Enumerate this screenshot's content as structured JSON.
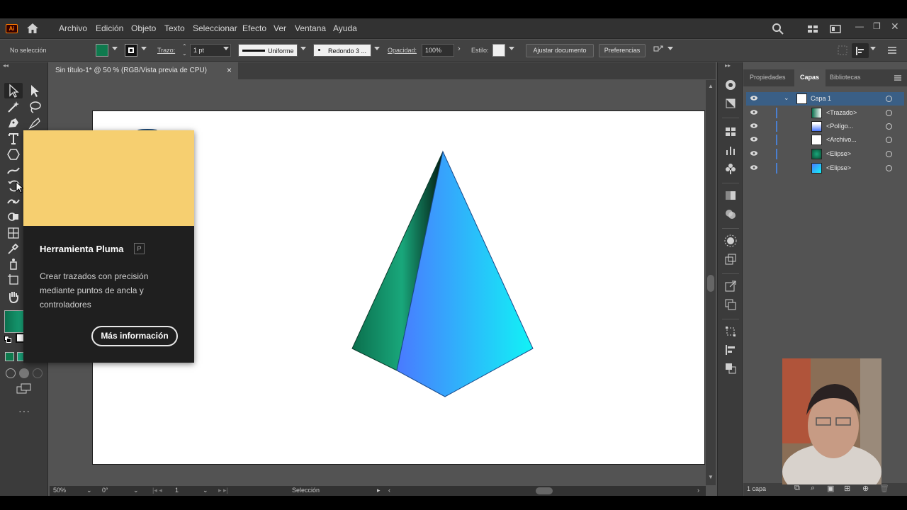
{
  "menubar": {
    "logo": "Ai",
    "items": [
      "Archivo",
      "Edición",
      "Objeto",
      "Texto",
      "Seleccionar",
      "Efecto",
      "Ver",
      "Ventana",
      "Ayuda"
    ],
    "icons": [
      "home-icon",
      "search-icon",
      "arrange-documents-icon",
      "screen-mode-icon",
      "minimize-icon",
      "restore-icon",
      "close-icon"
    ]
  },
  "controlbar": {
    "selection_status": "No selección",
    "stroke_label": "Trazo:",
    "stroke_weight": "1 pt",
    "stroke_profile": "Uniforme",
    "brush": "Redondo 3 ...",
    "opacity_label": "Opacidad:",
    "opacity_value": "100%",
    "style_label": "Estilo:",
    "adjust_document_button": "Ajustar documento",
    "preferences_button": "Preferencias",
    "colors": {
      "fill": "#0f7a4e",
      "stroke": "#111111"
    }
  },
  "document": {
    "tab_title": "Sin título-1* @ 50 % (RGB/Vista previa de CPU)",
    "tab_close": "×"
  },
  "tooltip": {
    "title": "Herramienta Pluma",
    "shortcut": "P",
    "description": "Crear trazados con precisión mediante puntos de ancla y controladores",
    "more_button": "Más información",
    "preview_color": "#f6cf70"
  },
  "statusbar": {
    "zoom": "50%",
    "rotation": "0°",
    "artboard_number": "1",
    "tool_status": "Selección"
  },
  "layers_panel": {
    "tabs": [
      "Propiedades",
      "Capas",
      "Bibliotecas"
    ],
    "active_tab": "Capas",
    "layer_name": "Capa 1",
    "items": [
      "<Trazado>",
      "<Polígo...",
      "<Archivo...",
      "<Elipse>",
      "<Elipse>"
    ],
    "footer": "1 capa"
  },
  "artwork": {
    "colors": {
      "green_dark": "#0b6f4d",
      "green_light": "#19a77b",
      "blue": "#4a79ff",
      "cyan": "#11f3f6",
      "shade": "#031a12"
    }
  }
}
